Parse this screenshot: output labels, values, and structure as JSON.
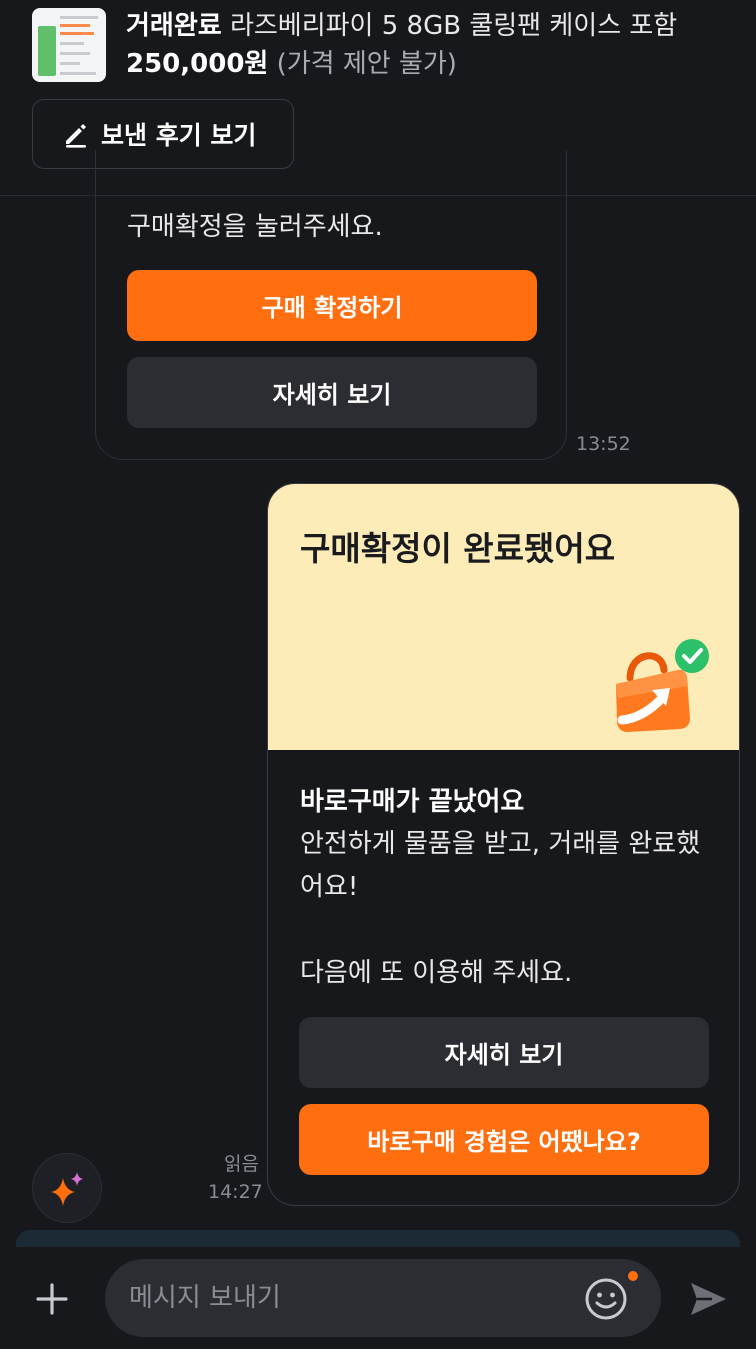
{
  "header": {
    "status": "거래완료",
    "product_title": "라즈베리파이 5 8GB 쿨링팬 케이스 포함",
    "price": "250,000원",
    "price_note": "(가격 제안 불가)",
    "review_button_label": "보낸 후기 보기"
  },
  "messages": {
    "prev_card": {
      "text": "구매확정을 눌러주세요.",
      "confirm_button": "구매 확정하기",
      "detail_button": "자세히 보기",
      "time": "13:52"
    },
    "complete_card": {
      "banner_title": "구매확정이 완료됐어요",
      "title": "바로구매가 끝났어요",
      "text": "안전하게 물품을 받고, 거래를 완료했어요!",
      "text2": "다음에 또 이용해 주세요.",
      "detail_button": "자세히 보기",
      "feedback_button": "바로구매 경험은 어땠나요?",
      "read_label": "읽음",
      "time": "14:27"
    }
  },
  "input": {
    "placeholder": "메시지 보내기"
  },
  "colors": {
    "accent": "#ff6f0f",
    "background": "#17181c",
    "banner": "#fdecb7",
    "button_dark": "#2c2d33"
  },
  "icons": [
    "pencil-icon",
    "sparkle-icon",
    "plus-icon",
    "emoji-icon",
    "send-icon",
    "shopping-bag-check-icon"
  ]
}
